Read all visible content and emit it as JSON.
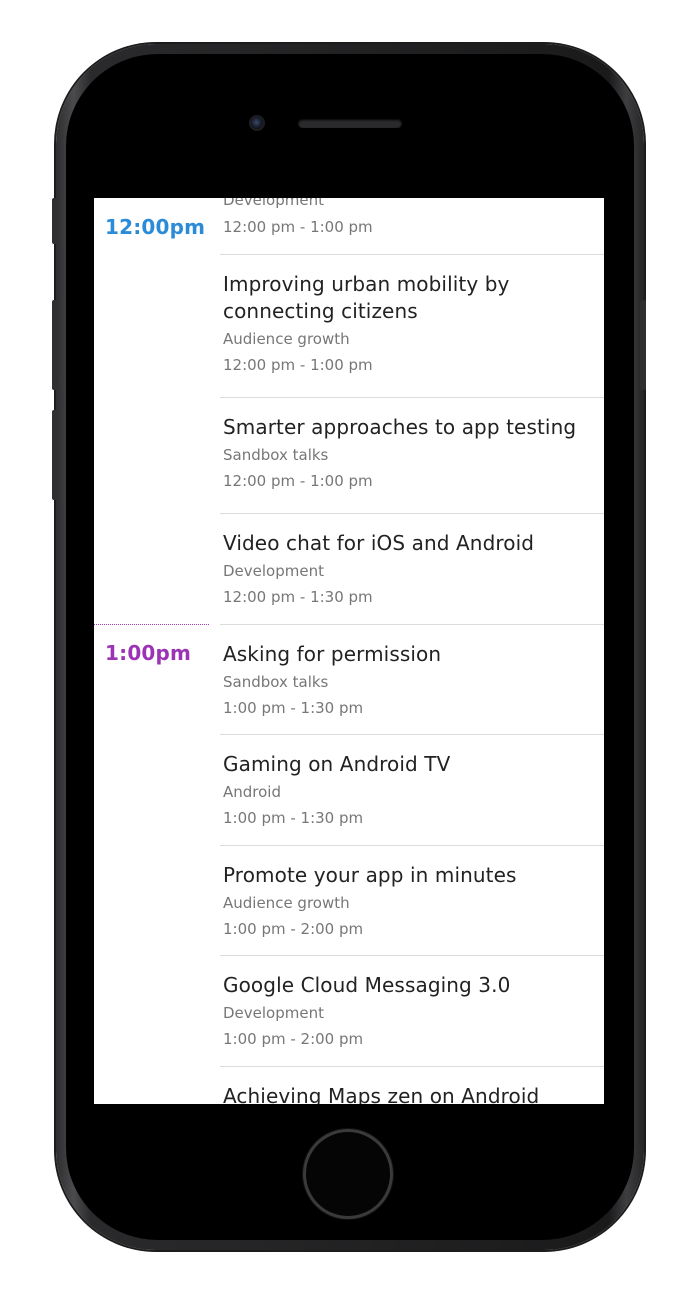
{
  "schedule": {
    "time_labels": {
      "noon": {
        "text": "12:00pm",
        "color": "#2a8bd8"
      },
      "one": {
        "text": "1:00pm",
        "color": "#9b33b4"
      }
    },
    "sessions": [
      {
        "title": "",
        "track": "Development",
        "time": "12:00 pm - 1:00 pm"
      },
      {
        "title_line1": "Improving urban mobility by",
        "title_line2": "connecting citizens",
        "track": "Audience growth",
        "time": "12:00 pm - 1:00 pm"
      },
      {
        "title": "Smarter approaches to app testing",
        "track": "Sandbox talks",
        "time": "12:00 pm - 1:00 pm"
      },
      {
        "title": "Video chat for iOS and Android",
        "track": "Development",
        "time": "12:00 pm - 1:30 pm"
      },
      {
        "title": "Asking for permission",
        "track": "Sandbox talks",
        "time": "1:00 pm - 1:30 pm"
      },
      {
        "title": "Gaming on Android TV",
        "track": "Android",
        "time": "1:00 pm - 1:30 pm"
      },
      {
        "title": "Promote your app in minutes",
        "track": "Audience growth",
        "time": "1:00 pm - 2:00 pm"
      },
      {
        "title": "Google Cloud Messaging 3.0",
        "track": "Development",
        "time": "1:00 pm - 2:00 pm"
      },
      {
        "title": "Achieving Maps zen on Android",
        "track": "",
        "time": ""
      }
    ]
  }
}
